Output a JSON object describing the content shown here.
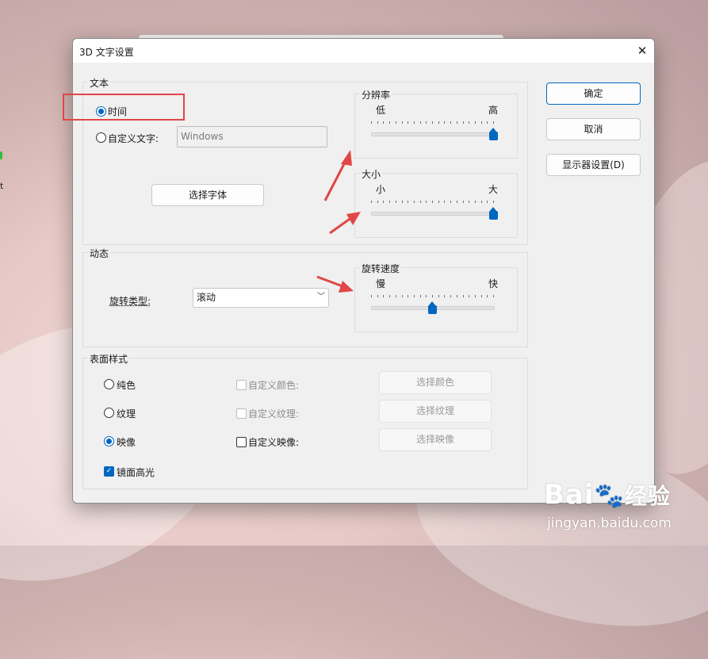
{
  "dialog": {
    "title": "3D 文字设置",
    "close_label": "✕"
  },
  "text_group": {
    "label": "文本",
    "time_label": "时间",
    "custom_label": "自定义文字:",
    "custom_value": "Windows",
    "font_button": "选择字体"
  },
  "resolution": {
    "label": "分辨率",
    "low": "低",
    "high": "高",
    "value": 1.0
  },
  "size": {
    "label": "大小",
    "small": "小",
    "large": "大",
    "value": 1.0
  },
  "motion_group": {
    "label": "动态",
    "rotation_type_label": "旋转类型:",
    "rotation_type_value": "滚动",
    "speed_label": "旋转速度",
    "slow": "慢",
    "fast": "快",
    "speed_value": 0.5
  },
  "surface_group": {
    "label": "表面样式",
    "solid": "纯色",
    "texture": "纹理",
    "reflection": "映像",
    "custom_color": "自定义颜色:",
    "custom_texture": "自定义纹理:",
    "custom_reflection": "自定义映像:",
    "pick_color": "选择颜色",
    "pick_texture": "选择纹理",
    "pick_reflection": "选择映像",
    "specular": "镜面高光"
  },
  "buttons": {
    "ok": "确定",
    "cancel": "取消",
    "display": "显示器设置(D)"
  },
  "watermark": {
    "brand": "Bai",
    "brand_cn": "经验",
    "url": "jingyan.baidu.com"
  },
  "colors": {
    "accent": "#0067c0",
    "annotation": "#e24646"
  }
}
